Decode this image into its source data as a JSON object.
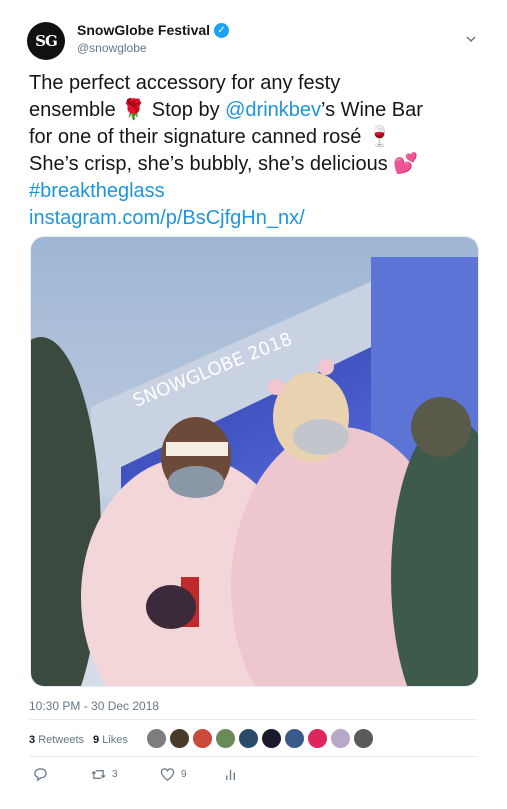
{
  "account": {
    "avatar_text": "SG",
    "display_name": "SnowGlobe Festival",
    "handle": "@snowglobe",
    "verified_icon": "verified-badge-icon"
  },
  "tweet": {
    "line1": "The perfect accessory for any festy",
    "line2_a": "ensemble ",
    "emoji_rose": "🌹",
    "line2_b": " Stop by ",
    "mention": "@drinkbev",
    "line2_c": "’s Wine Bar",
    "line3": "for one of their signature canned rosé ",
    "emoji_wine": "🍷",
    "line4": "She’s crisp, she’s bubbly, she’s delicious ",
    "emoji_hearts": "💕",
    "hashtag": "#breaktheglass",
    "link": "instagram.com/p/BsCjfgHn_nx/"
  },
  "photo": {
    "stage_banner": "SNOWGLOBE 2018"
  },
  "timestamp": "10:30 PM - 30 Dec 2018",
  "stats": {
    "retweets_count": "3",
    "retweets_label": "Retweets",
    "likes_count": "9",
    "likes_label": "Likes"
  },
  "actions": {
    "reply_icon": "reply-icon",
    "retweet_icon": "retweet-icon",
    "retweet_count": "3",
    "like_icon": "heart-icon",
    "like_count": "9",
    "analytics_icon": "analytics-icon"
  },
  "colors": {
    "link": "#1b95e0",
    "secondary_text": "#657786",
    "verified": "#1da1f2",
    "divider": "#e6ecf0"
  }
}
